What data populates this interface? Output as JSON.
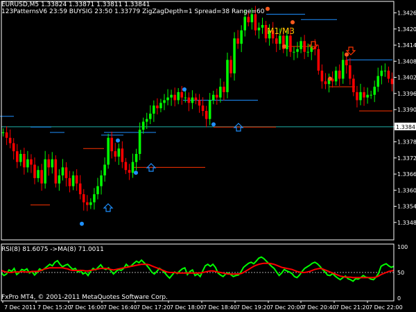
{
  "header": {
    "symbol_line": "EURUSD,M5  1.33824 1.33871 1.33811 1.33841",
    "indicator_line": "123PatternsV6  23:59  BUYSIG  23:50  1.33779  ZigZagDepth=1  Spread=38  Range=60"
  },
  "sub_window": {
    "title": "RSI(8) 81.6075  ->MA(8) 71.0011"
  },
  "annotation": {
    "text": "M1/M3"
  },
  "footer": {
    "copyright": "FxPro MT4, © 2001-2011 MetaQuotes Software Corp."
  },
  "colors": {
    "background": "#000000",
    "bull_candle": "#00ff00",
    "bear_candle": "#ff0000",
    "grid_frame": "#ffffff",
    "current_price_line": "#20b2aa",
    "pattern_blue": "#1e90ff",
    "pattern_red": "#ff3300",
    "swing_orange": "#ff5a1e",
    "rsi_line": "#00ff00",
    "rsi_ma_line": "#ff0000"
  },
  "chart_data": [
    {
      "type": "candlestick",
      "symbol": "EURUSD",
      "timeframe": "M5",
      "ylim": [
        1.3342,
        1.343
      ],
      "y_ticks": [
        "1.34265",
        "1.34205",
        "1.34145",
        "1.34085",
        "1.34025",
        "1.33965",
        "1.33905",
        "1.33841",
        "1.33785",
        "1.33725",
        "1.33665",
        "1.33605",
        "1.33545",
        "1.33485"
      ],
      "current_price": "1.33841",
      "x_ticks": [
        "7 Dec 2011",
        "7 Dec 15:20",
        "7 Dec 16:00",
        "7 Dec 16:40",
        "7 Dec 17:20",
        "7 Dec 18:00",
        "7 Dec 18:40",
        "7 Dec 19:20",
        "7 Dec 20:00",
        "7 Dec 20:40",
        "7 Dec 21:20",
        "7 Dec 22:00"
      ],
      "close": [
        1.3382,
        1.338,
        1.3378,
        1.3375,
        1.3371,
        1.3374,
        1.3369,
        1.3372,
        1.337,
        1.3365,
        1.3368,
        1.3363,
        1.3372,
        1.3369,
        1.3372,
        1.3363,
        1.3366,
        1.3369,
        1.3365,
        1.3362,
        1.3366,
        1.3363,
        1.3359,
        1.3356,
        1.3355,
        1.3356,
        1.3359,
        1.3362,
        1.3366,
        1.337,
        1.338,
        1.3375,
        1.3373,
        1.3376,
        1.3371,
        1.3368,
        1.3367,
        1.3371,
        1.3374,
        1.3383,
        1.3386,
        1.3387,
        1.3389,
        1.3392,
        1.3391,
        1.3393,
        1.3394,
        1.3395,
        1.3396,
        1.3394,
        1.3397,
        1.3395,
        1.3395,
        1.3393,
        1.3395,
        1.3394,
        1.3392,
        1.339,
        1.3387,
        1.3394,
        1.3396,
        1.3395,
        1.3399,
        1.3397,
        1.3409,
        1.3404,
        1.3417,
        1.3415,
        1.342,
        1.3425,
        1.3423,
        1.3426,
        1.342,
        1.3421,
        1.3422,
        1.3417,
        1.342,
        1.3417,
        1.3415,
        1.3418,
        1.3413,
        1.3418,
        1.3412,
        1.3412,
        1.3413,
        1.3416,
        1.3412,
        1.3412,
        1.3414,
        1.3413,
        1.3405,
        1.3401,
        1.34,
        1.3402,
        1.3401,
        1.3405,
        1.3402,
        1.3409,
        1.3407,
        1.3402,
        1.3397,
        1.3394,
        1.3397,
        1.3395,
        1.3396,
        1.3396,
        1.3399,
        1.3403,
        1.3405,
        1.3405,
        1.3402,
        1.34
      ],
      "rsi": {
        "series": [
          {
            "name": "RSI(8)",
            "values": [
              49,
              44,
              47,
              55,
              52,
              58,
              46,
              50,
              56,
              54,
              57,
              49,
              52,
              45,
              50,
              57,
              54,
              58,
              62,
              66,
              63,
              70,
              73,
              66,
              61,
              64,
              66,
              61,
              56,
              58,
              51,
              54,
              47,
              50,
              44,
              52,
              58,
              55,
              60,
              65,
              58,
              56,
              59,
              53,
              47,
              52,
              56,
              54,
              58,
              66,
              61,
              63,
              68,
              72,
              69,
              74,
              69,
              64,
              58,
              51,
              47,
              52,
              58,
              55,
              50,
              44,
              39,
              45,
              51,
              48,
              53,
              57,
              59,
              46,
              52,
              55,
              44,
              47,
              42,
              53,
              63,
              66,
              62,
              66,
              60,
              49,
              45,
              42,
              47,
              49,
              46,
              42,
              44,
              45,
              51,
              60,
              64,
              68,
              70,
              67,
              72,
              78,
              80,
              77,
              72,
              67,
              62,
              58,
              51,
              44,
              49,
              56,
              53,
              51,
              48,
              42,
              40,
              45,
              52,
              58,
              61,
              64,
              68,
              70,
              67,
              62,
              56,
              51,
              45,
              44,
              48,
              43,
              39,
              36,
              40,
              43,
              38,
              36,
              33,
              38,
              37,
              40,
              44,
              41,
              40,
              37,
              36,
              41,
              48,
              62,
              65,
              67,
              63,
              60,
              62
            ]
          },
          {
            "name": "MA(8)",
            "values": [
              54,
              52,
              51,
              50,
              50,
              51,
              51,
              51,
              52,
              51,
              51,
              51,
              52,
              52,
              52,
              53,
              55,
              57,
              58,
              59,
              59,
              59,
              59,
              59,
              59,
              58,
              57,
              55,
              54,
              54,
              54,
              54,
              54,
              53,
              53,
              54,
              55,
              56,
              57,
              58,
              58,
              58,
              57,
              56,
              55,
              56,
              57,
              58,
              59,
              60,
              61,
              62,
              63,
              64,
              65,
              66,
              66,
              66,
              65,
              63,
              61,
              59,
              57,
              55,
              53,
              51,
              50,
              50,
              50,
              49,
              49,
              49,
              49,
              49,
              49,
              49,
              49,
              49,
              49,
              50,
              51,
              52,
              53,
              53,
              52,
              51,
              50,
              49,
              48,
              47,
              47,
              47,
              47,
              47,
              48,
              50,
              53,
              56,
              59,
              62,
              64,
              66,
              67,
              68,
              68,
              68,
              67,
              66,
              64,
              62,
              60,
              59,
              58,
              57,
              56,
              54,
              52,
              51,
              50,
              50,
              51,
              52,
              54,
              56,
              57,
              58,
              57,
              55,
              53,
              51,
              49,
              47,
              45,
              43,
              42,
              41,
              41,
              41,
              40,
              40,
              40,
              40,
              40,
              40,
              40,
              40,
              40,
              41,
              43,
              46,
              48,
              50,
              52,
              53,
              54
            ]
          }
        ],
        "ylim": [
          0,
          100
        ],
        "y_ticks": [
          "100",
          "50",
          "0"
        ],
        "reference_level": 50
      }
    }
  ]
}
